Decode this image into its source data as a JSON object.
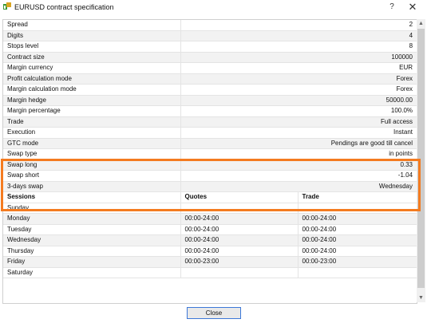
{
  "window": {
    "title": "EURUSD contract specification",
    "help_glyph": "?",
    "close_glyph": "✕"
  },
  "highlight_color": "#f47b20",
  "spec_rows": [
    {
      "label": "Spread",
      "value": "2"
    },
    {
      "label": "Digits",
      "value": "4"
    },
    {
      "label": "Stops level",
      "value": "8"
    },
    {
      "label": "Contract size",
      "value": "100000"
    },
    {
      "label": "Margin currency",
      "value": "EUR"
    },
    {
      "label": "Profit calculation mode",
      "value": "Forex"
    },
    {
      "label": "Margin calculation mode",
      "value": "Forex"
    },
    {
      "label": "Margin hedge",
      "value": "50000.00"
    },
    {
      "label": "Margin percentage",
      "value": "100.0%"
    },
    {
      "label": "Trade",
      "value": "Full access"
    },
    {
      "label": "Execution",
      "value": "Instant"
    },
    {
      "label": "GTC mode",
      "value": "Pendings are good till cancel"
    },
    {
      "label": "Swap type",
      "value": "in points"
    },
    {
      "label": "Swap long",
      "value": "0.33"
    },
    {
      "label": "Swap short",
      "value": "-1.04"
    },
    {
      "label": "3-days swap",
      "value": "Wednesday"
    }
  ],
  "sessions": {
    "headers": [
      "Sessions",
      "Quotes",
      "Trade"
    ],
    "rows": [
      {
        "day": "Sunday",
        "quotes": "",
        "trade": ""
      },
      {
        "day": "Monday",
        "quotes": "00:00-24:00",
        "trade": "00:00-24:00"
      },
      {
        "day": "Tuesday",
        "quotes": "00:00-24:00",
        "trade": "00:00-24:00"
      },
      {
        "day": "Wednesday",
        "quotes": "00:00-24:00",
        "trade": "00:00-24:00"
      },
      {
        "day": "Thursday",
        "quotes": "00:00-24:00",
        "trade": "00:00-24:00"
      },
      {
        "day": "Friday",
        "quotes": "00:00-23:00",
        "trade": "00:00-23:00"
      },
      {
        "day": "Saturday",
        "quotes": "",
        "trade": ""
      }
    ]
  },
  "scrollbar": {
    "up_glyph": "▲",
    "down_glyph": "▼"
  },
  "footer": {
    "close_label": "Close"
  }
}
